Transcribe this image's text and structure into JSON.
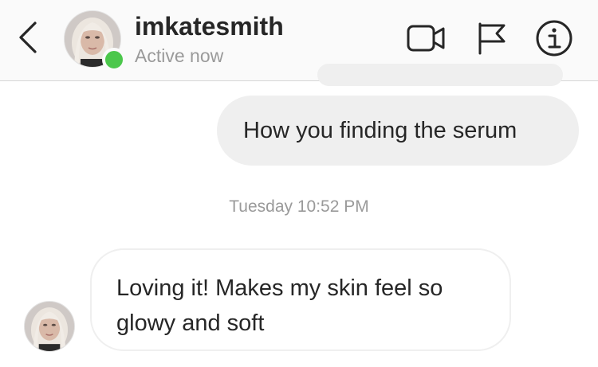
{
  "header": {
    "back_icon": "chevron-left-icon",
    "username": "imkatesmith",
    "status": "Active now",
    "status_color": "#4bc74b",
    "actions": [
      {
        "icon": "video-camera-icon"
      },
      {
        "icon": "flag-icon"
      },
      {
        "icon": "info-icon"
      }
    ]
  },
  "messages": {
    "outgoing": {
      "text": "How you finding the serum"
    },
    "timestamp": "Tuesday 10:52 PM",
    "incoming": {
      "text": "Loving it! Makes my skin feel so glowy and soft"
    }
  },
  "colors": {
    "bubble_gray": "#efefef",
    "text": "#262626",
    "muted": "#9a9a9a"
  }
}
